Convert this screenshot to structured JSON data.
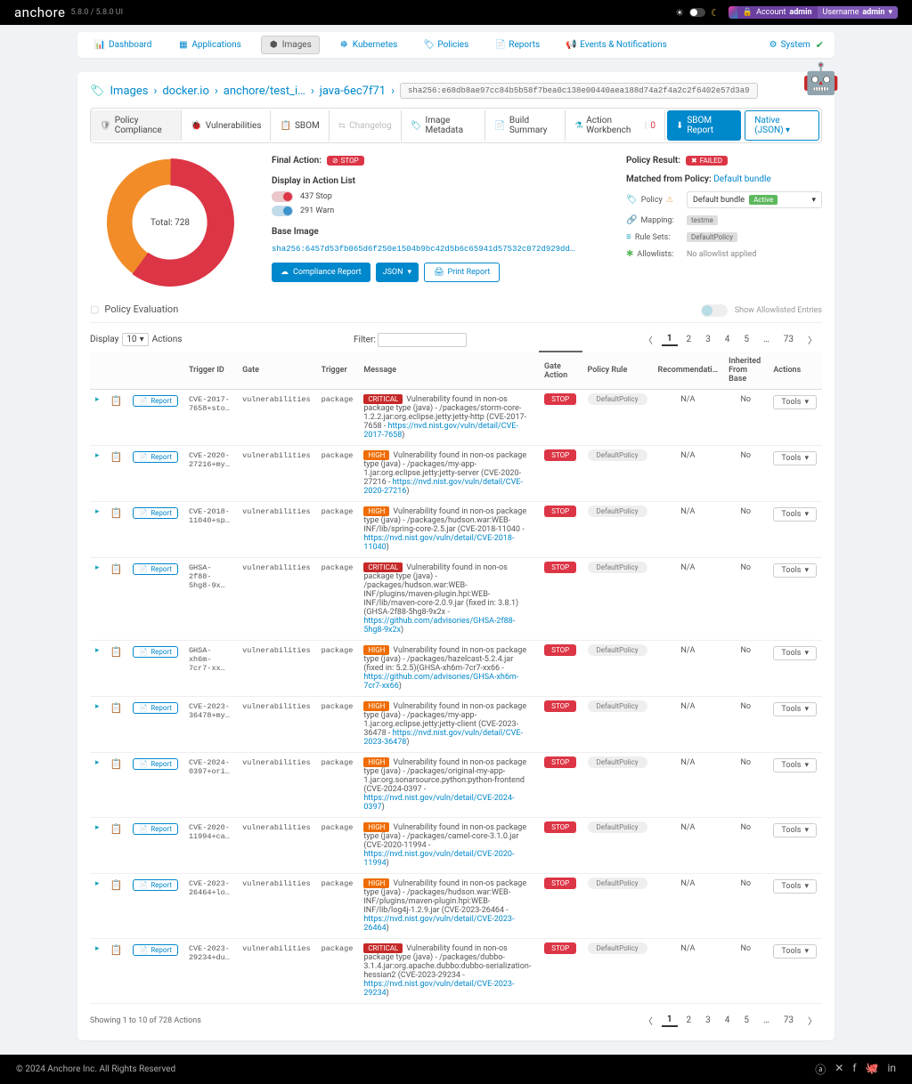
{
  "brand": {
    "name": "anchore",
    "version": "5.8.0 / 5.8.0 UI"
  },
  "account": {
    "prefix": "Account",
    "account": "admin",
    "user_prefix": "Username",
    "user": "admin"
  },
  "nav": {
    "items": [
      {
        "label": "Dashboard"
      },
      {
        "label": "Applications"
      },
      {
        "label": "Images"
      },
      {
        "label": "Kubernetes"
      },
      {
        "label": "Policies"
      },
      {
        "label": "Reports"
      },
      {
        "label": "Events & Notifications"
      }
    ],
    "system": "System"
  },
  "breadcrumb": {
    "root": "Images",
    "registry": "docker.io",
    "repo": "anchore/test_i…",
    "tag": "java-6ec7f71",
    "sha": "sha256:e68db8ae97cc84b5b58f7bea0c138e00440aea188d74a2f4a2c2f6402e57d3a9"
  },
  "tabs": {
    "items": [
      {
        "label": "Policy Compliance"
      },
      {
        "label": "Vulnerabilities"
      },
      {
        "label": "SBOM"
      },
      {
        "label": "Changelog"
      },
      {
        "label": "Image Metadata"
      },
      {
        "label": "Build Summary"
      },
      {
        "label": "Action Workbench",
        "count": "0"
      }
    ],
    "sbom_report": "SBOM Report",
    "native_json": "Native (JSON)"
  },
  "summary": {
    "final_action_label": "Final Action:",
    "final_action_value": "STOP",
    "display_list_title": "Display in Action List",
    "stop_line": "437 Stop",
    "warn_line": "291 Warn",
    "base_image_title": "Base Image",
    "base_image_sha": "sha256:6457d53fb065d6f250e1504b9bc42d5b6c65941d57532c072d929dd…",
    "compliance_btn": "Compliance Report",
    "json_btn": "JSON",
    "print_btn": "Print Report"
  },
  "match": {
    "policy_result_label": "Policy Result:",
    "policy_result_value": "FAILED",
    "from_label": "Matched from Policy:",
    "from_value": "Default bundle",
    "policy_label": "Policy",
    "policy_value": "Default bundle",
    "policy_badge": "Active",
    "mapping_label": "Mapping:",
    "mapping_value": "testme",
    "ruleset_label": "Rule Sets:",
    "ruleset_value": "DefaultPolicy",
    "allowlist_label": "Allowlists:",
    "allowlist_value": "No allowlist applied"
  },
  "chart_data": {
    "type": "pie",
    "title": "Total: 728",
    "series": [
      {
        "name": "Stop",
        "value": 437,
        "color": "#dc3545"
      },
      {
        "name": "Warn",
        "value": 291,
        "color": "#f28c28"
      }
    ]
  },
  "evaluation": {
    "title": "Policy Evaluation",
    "allow_label": "Show Allowlisted Entries",
    "display_label": "Display",
    "display_value": "10",
    "actions_label": "Actions",
    "filter_label": "Filter:",
    "pages": [
      "〈",
      "1",
      "2",
      "3",
      "4",
      "5",
      "…",
      "73",
      "〉"
    ],
    "columns": {
      "trigger_id": "Trigger ID",
      "gate": "Gate",
      "trigger": "Trigger",
      "message": "Message",
      "gate_action": "Gate Action",
      "policy_rule": "Policy Rule",
      "recommendation": "Recommendati…",
      "inherited": "Inherited From Base",
      "actions": "Actions"
    },
    "row_report_label": "Report",
    "tools_label": "Tools",
    "summary_line": "Showing 1 to 10 of 728 Actions",
    "rows": [
      {
        "severity": "CRITICAL",
        "trigger_id": "CVE-2017-7658+sto…",
        "gate": "vulnerabilities",
        "trigger": "package",
        "msg_pre": "Vulnerability found in non-os package type (java) - /packages/storm-core-1.2.2.jar:org.eclipse.jetty:jetty-http (CVE-2017-7658 - ",
        "link": "https://nvd.nist.gov/vuln/detail/CVE-2017-7658",
        "msg_post": ")",
        "gate_action": "STOP",
        "policy_rule": "DefaultPolicy",
        "recommendation": "N/A",
        "inherited": "No"
      },
      {
        "severity": "HIGH",
        "trigger_id": "CVE-2020-27216+my…",
        "gate": "vulnerabilities",
        "trigger": "package",
        "msg_pre": "Vulnerability found in non-os package type (java) - /packages/my-app-1.jar:org.eclipse.jetty:jetty-server (CVE-2020-27216 - ",
        "link": "https://nvd.nist.gov/vuln/detail/CVE-2020-27216",
        "msg_post": ")",
        "gate_action": "STOP",
        "policy_rule": "DefaultPolicy",
        "recommendation": "N/A",
        "inherited": "No"
      },
      {
        "severity": "HIGH",
        "trigger_id": "CVE-2018-11040+sp…",
        "gate": "vulnerabilities",
        "trigger": "package",
        "msg_pre": "Vulnerability found in non-os package type (java) - /packages/hudson.war:WEB-INF/lib/spring-core-2.5.jar (CVE-2018-11040 - ",
        "link": "https://nvd.nist.gov/vuln/detail/CVE-2018-11040",
        "msg_post": ")",
        "gate_action": "STOP",
        "policy_rule": "DefaultPolicy",
        "recommendation": "N/A",
        "inherited": "No"
      },
      {
        "severity": "CRITICAL",
        "trigger_id": "GHSA-2f88-5hg8-9x…",
        "gate": "vulnerabilities",
        "trigger": "package",
        "msg_pre": "Vulnerability found in non-os package type (java) - /packages/hudson.war:WEB-INF/plugins/maven-plugin.hpi:WEB-INF/lib/maven-core-2.0.9.jar (fixed in: 3.8.1)(GHSA-2f88-5hg8-9x2x - ",
        "link": "https://github.com/advisories/GHSA-2f88-5hg8-9x2x",
        "msg_post": ")",
        "gate_action": "STOP",
        "policy_rule": "DefaultPolicy",
        "recommendation": "N/A",
        "inherited": "No"
      },
      {
        "severity": "HIGH",
        "trigger_id": "GHSA-xh6m-7cr7-xx…",
        "gate": "vulnerabilities",
        "trigger": "package",
        "msg_pre": "Vulnerability found in non-os package type (java) - /packages/hazelcast-5.2.4.jar (fixed in: 5.2.5)(GHSA-xh6m-7cr7-xx66 - ",
        "link": "https://github.com/advisories/GHSA-xh6m-7cr7-xx66",
        "msg_post": ")",
        "gate_action": "STOP",
        "policy_rule": "DefaultPolicy",
        "recommendation": "N/A",
        "inherited": "No"
      },
      {
        "severity": "HIGH",
        "trigger_id": "CVE-2023-36478+my…",
        "gate": "vulnerabilities",
        "trigger": "package",
        "msg_pre": "Vulnerability found in non-os package type (java) - /packages/my-app-1.jar:org.eclipse.jetty:jetty-client (CVE-2023-36478 - ",
        "link": "https://nvd.nist.gov/vuln/detail/CVE-2023-36478",
        "msg_post": ")",
        "gate_action": "STOP",
        "policy_rule": "DefaultPolicy",
        "recommendation": "N/A",
        "inherited": "No"
      },
      {
        "severity": "HIGH",
        "trigger_id": "CVE-2024-0397+ori…",
        "gate": "vulnerabilities",
        "trigger": "package",
        "msg_pre": "Vulnerability found in non-os package type (java) - /packages/original-my-app-1.jar:org.sonarsource.python:python-frontend (CVE-2024-0397 - ",
        "link": "https://nvd.nist.gov/vuln/detail/CVE-2024-0397",
        "msg_post": ")",
        "gate_action": "STOP",
        "policy_rule": "DefaultPolicy",
        "recommendation": "N/A",
        "inherited": "No"
      },
      {
        "severity": "HIGH",
        "trigger_id": "CVE-2020-11994+ca…",
        "gate": "vulnerabilities",
        "trigger": "package",
        "msg_pre": "Vulnerability found in non-os package type (java) - /packages/camel-core-3.1.0.jar (CVE-2020-11994 - ",
        "link": "https://nvd.nist.gov/vuln/detail/CVE-2020-11994",
        "msg_post": ")",
        "gate_action": "STOP",
        "policy_rule": "DefaultPolicy",
        "recommendation": "N/A",
        "inherited": "No"
      },
      {
        "severity": "HIGH",
        "trigger_id": "CVE-2023-26464+lo…",
        "gate": "vulnerabilities",
        "trigger": "package",
        "msg_pre": "Vulnerability found in non-os package type (java) - /packages/hudson.war:WEB-INF/plugins/maven-plugin.hpi:WEB-INF/lib/log4j-1.2.9.jar (CVE-2023-26464 - ",
        "link": "https://nvd.nist.gov/vuln/detail/CVE-2023-26464",
        "msg_post": ")",
        "gate_action": "STOP",
        "policy_rule": "DefaultPolicy",
        "recommendation": "N/A",
        "inherited": "No"
      },
      {
        "severity": "CRITICAL",
        "trigger_id": "CVE-2023-29234+du…",
        "gate": "vulnerabilities",
        "trigger": "package",
        "msg_pre": "Vulnerability found in non-os package type (java) - /packages/dubbo-3.1.4.jar:org.apache.dubbo:dubbo-serialization-hessian2 (CVE-2023-29234 - ",
        "link": "https://nvd.nist.gov/vuln/detail/CVE-2023-29234",
        "msg_post": ")",
        "gate_action": "STOP",
        "policy_rule": "DefaultPolicy",
        "recommendation": "N/A",
        "inherited": "No"
      }
    ]
  },
  "footer": {
    "copyright": "© 2024 Anchore Inc. All Rights Reserved"
  }
}
